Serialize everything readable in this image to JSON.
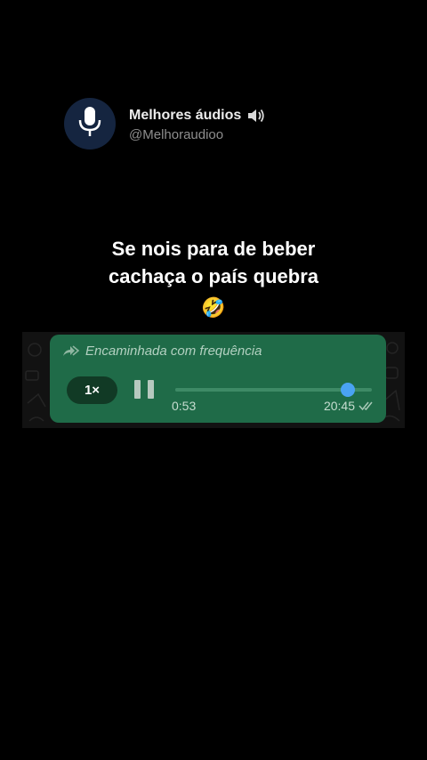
{
  "post": {
    "author_name": "Melhores áudios",
    "author_handle": "@Melhoraudioo",
    "avatar_icon": "microphone-icon",
    "name_icon": "speaker-icon",
    "caption_line1": "Se nois para de beber",
    "caption_line2": "cachaça o país quebra",
    "caption_emoji": "🤣"
  },
  "voice_message": {
    "forwarded_label": "Encaminhada com frequência",
    "forwarded_icon": "double-forward-arrow-icon",
    "speed_label": "1×",
    "play_state_icon": "pause-icon",
    "elapsed": "0:53",
    "progress": 0.88,
    "time_sent": "20:45",
    "status_icon": "double-check-icon"
  },
  "colors": {
    "background": "#000000",
    "bubble": "#1f6b48",
    "avatar_bg": "#152540",
    "knob": "#4aa3f2"
  }
}
